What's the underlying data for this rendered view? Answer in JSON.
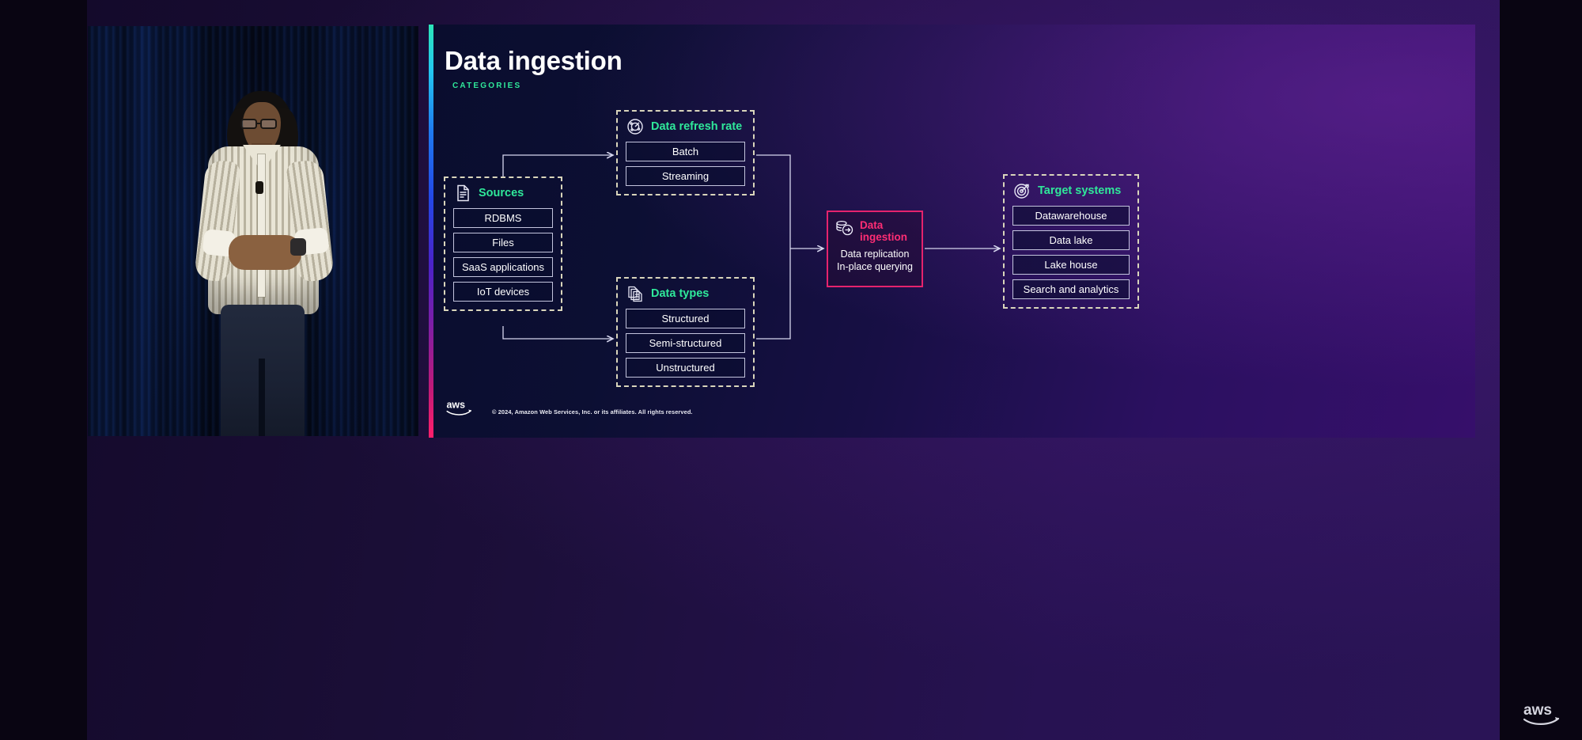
{
  "slide": {
    "title": "Data ingestion",
    "subtitle": "CATEGORIES",
    "accent_colors": {
      "title_green": "#2fe89a",
      "highlight_pink": "#ff2d74",
      "group_border": "#d9d5bb",
      "chip_border": "#c3c4dd"
    },
    "groups": [
      {
        "id": "sources",
        "icon": "document-icon",
        "title": "Sources",
        "items": [
          "RDBMS",
          "Files",
          "SaaS applications",
          "IoT devices"
        ]
      },
      {
        "id": "refresh",
        "icon": "radar-icon",
        "title": "Data refresh rate",
        "items": [
          "Batch",
          "Streaming"
        ]
      },
      {
        "id": "types",
        "icon": "documents-stack-icon",
        "title": "Data types",
        "items": [
          "Structured",
          "Semi-structured",
          "Unstructured"
        ]
      },
      {
        "id": "target",
        "icon": "target-icon",
        "title": "Target systems",
        "items": [
          "Datawarehouse",
          "Data lake",
          "Lake house",
          "Search and analytics"
        ]
      }
    ],
    "center_box": {
      "icon": "database-arrow-icon",
      "title_line1": "Data",
      "title_line2": "ingestion",
      "detail_line1": "Data replication",
      "detail_line2": "In-place querying"
    },
    "footer": {
      "logo": "aws-logo",
      "copyright": "© 2024, Amazon Web Services, Inc. or its affiliates. All rights reserved."
    }
  },
  "video": {
    "label": "presenter-on-stage"
  },
  "watermark": {
    "label": "aws-logo"
  }
}
